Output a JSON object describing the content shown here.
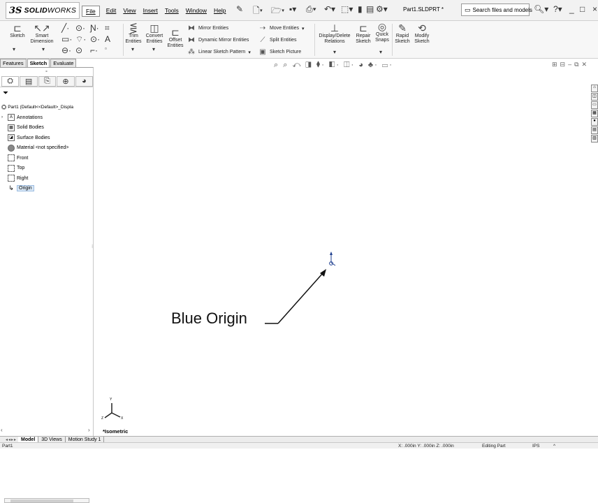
{
  "app": {
    "brand_ds": "3S",
    "brand_bold": "SOLID",
    "brand_light": "WORKS"
  },
  "menu": [
    "File",
    "Edit",
    "View",
    "Insert",
    "Tools",
    "Window",
    "Help"
  ],
  "document_title": "Part1.SLDPRT *",
  "search": {
    "placeholder": "Search files and models"
  },
  "ribbon": {
    "sketch": "Sketch",
    "smart_dimension": [
      "Smart",
      "Dimension"
    ],
    "trim_entities": [
      "Trim",
      "Entities"
    ],
    "convert_entities": [
      "Convert",
      "Entities"
    ],
    "offset_entities": [
      "Offset",
      "Entities"
    ],
    "mirror_entities": "Mirror Entities",
    "dynamic_mirror_entities": "Dynamic Mirror Entities",
    "linear_sketch_pattern": "Linear Sketch Pattern",
    "move_entities": "Move Entities",
    "split_entities": "Split Entities",
    "sketch_picture": "Sketch Picture",
    "display_delete_relations": [
      "Display/Delete",
      "Relations"
    ],
    "repair_sketch": [
      "Repair",
      "Sketch"
    ],
    "quick_snaps": [
      "Quick",
      "Snaps"
    ],
    "rapid_sketch": [
      "Rapid",
      "Sketch"
    ],
    "modify_sketch": [
      "Modify",
      "Sketch"
    ]
  },
  "command_tabs": [
    "Features",
    "Sketch",
    "Evaluate"
  ],
  "active_command_tab": "Sketch",
  "feature_tree": {
    "root": "Part1  (Default<<Default>_Displa",
    "items": [
      {
        "label": "Annotations",
        "icon": "annotations-icon"
      },
      {
        "label": "Solid Bodies",
        "icon": "solid-bodies-icon"
      },
      {
        "label": "Surface Bodies",
        "icon": "surface-bodies-icon"
      },
      {
        "label": "Material <not specified>",
        "icon": "material-icon"
      },
      {
        "label": "Front",
        "icon": "plane-icon"
      },
      {
        "label": "Top",
        "icon": "plane-icon"
      },
      {
        "label": "Right",
        "icon": "plane-icon"
      },
      {
        "label": "Origin",
        "icon": "origin-icon"
      }
    ]
  },
  "viewport": {
    "callout": "Blue Origin",
    "view_label": "*Isometric",
    "triad_labels": {
      "y": "Y",
      "x": "X",
      "z": "Z"
    }
  },
  "bottom_tabs": [
    "Model",
    "3D Views",
    "Motion Study 1"
  ],
  "active_bottom_tab": "Model",
  "status": {
    "left": "Part1",
    "coords": "X: .000in Y: .000in Z: .000in",
    "mode": "Editing Part",
    "units": "IPS"
  },
  "colors": {
    "origin_marker": "#1f3f8f",
    "selection": "#dbe9f7"
  }
}
